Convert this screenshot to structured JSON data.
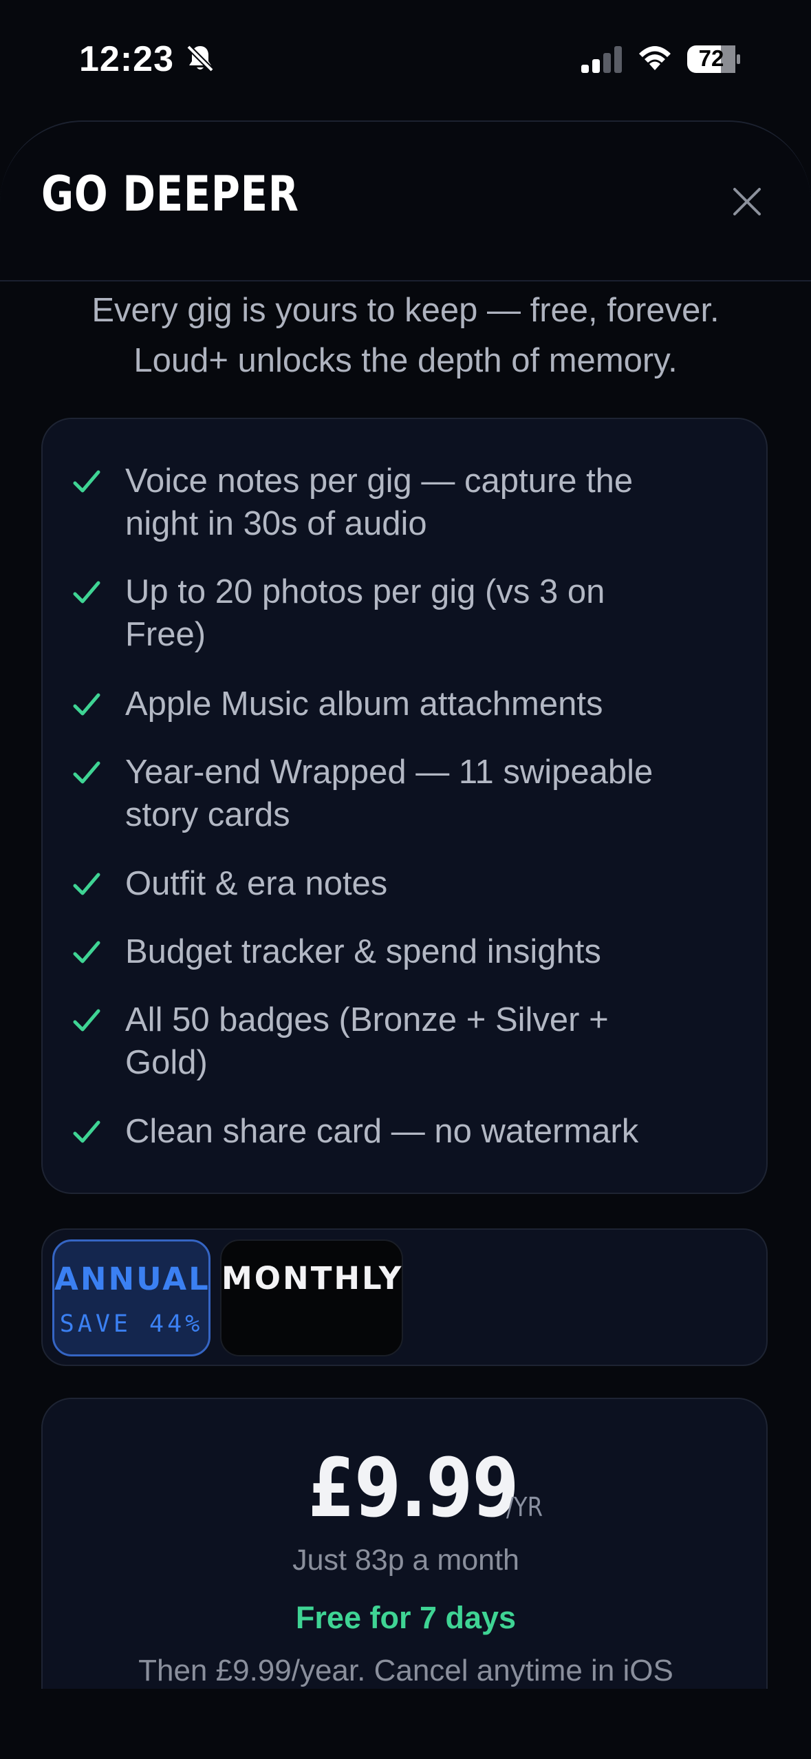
{
  "status_bar": {
    "time": "12:23",
    "battery": "72"
  },
  "sheet": {
    "title": "GO DEEPER",
    "subtitle_lines": [
      "Every gig is yours to keep — free, forever.",
      "Loud+ unlocks the depth of memory."
    ]
  },
  "features": [
    {
      "lines": [
        "Voice notes per gig — capture the",
        "night in 30s of audio"
      ]
    },
    {
      "lines": [
        "Up to 20 photos per gig (vs 3 on",
        "Free)"
      ]
    },
    {
      "lines": [
        "Apple Music album attachments"
      ]
    },
    {
      "lines": [
        "Year-end Wrapped — 11 swipeable",
        "story cards"
      ]
    },
    {
      "lines": [
        "Outfit & era notes"
      ]
    },
    {
      "lines": [
        "Budget tracker & spend insights"
      ]
    },
    {
      "lines": [
        "All 50 badges (Bronze + Silver +",
        "Gold)"
      ]
    },
    {
      "lines": [
        "Clean share card — no watermark"
      ]
    }
  ],
  "plans": {
    "annual": {
      "label": "ANNUAL",
      "save": "SAVE 44%",
      "selected": true
    },
    "monthly": {
      "label": "MONTHLY",
      "selected": false
    }
  },
  "pricing": {
    "price": "£9.99",
    "period": "/YR",
    "monthly_equivalent": "Just 83p a month",
    "trial": "Free for 7 days",
    "terms": "Then £9.99/year. Cancel anytime in iOS"
  },
  "colors": {
    "background": "#06080d",
    "card": "#0c1120",
    "accent_blue": "#3b80f2",
    "accent_green": "#3fd494"
  }
}
